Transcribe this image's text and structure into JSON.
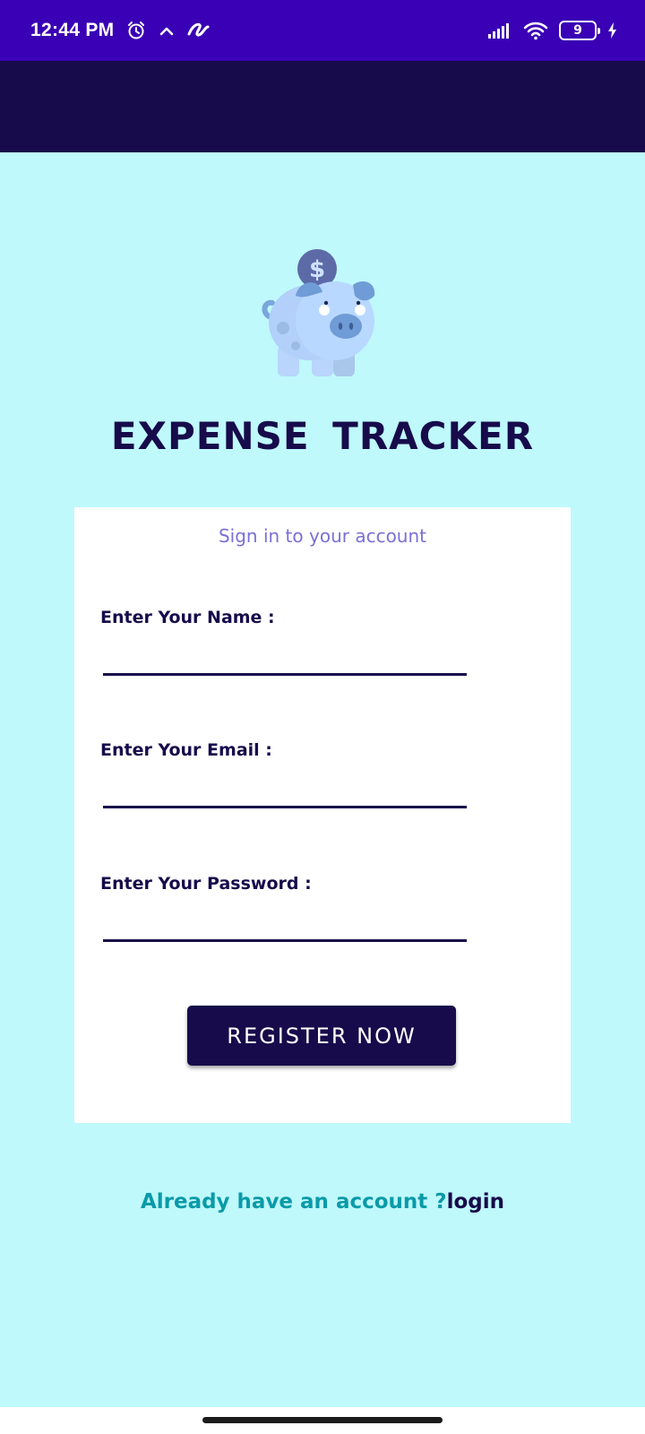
{
  "status_bar": {
    "time": "12:44 PM",
    "battery_level": "9",
    "icons": [
      "alarm-icon",
      "chevron-up-icon",
      "app-notification-icon",
      "signal-icon",
      "wifi-icon",
      "battery-icon",
      "charging-icon"
    ]
  },
  "app": {
    "title": "EXPENSE TRACKER",
    "logo_icon": "piggy-bank-icon"
  },
  "form": {
    "subtitle": "Sign in to your account",
    "name_label": "Enter Your Name :",
    "name_value": "",
    "email_label": "Enter Your Email :",
    "email_value": "",
    "password_label": "Enter Your Password :",
    "password_value": "",
    "submit_label": "REGISTER NOW"
  },
  "footer": {
    "prompt": "Already have an account ?",
    "login_link": "login"
  },
  "colors": {
    "status_bar": "#3a00b5",
    "app_bar": "#170b4b",
    "background": "#bff9fc",
    "card": "#ffffff",
    "accent_text": "#7b6fd6",
    "link_teal": "#0a9aa8"
  }
}
